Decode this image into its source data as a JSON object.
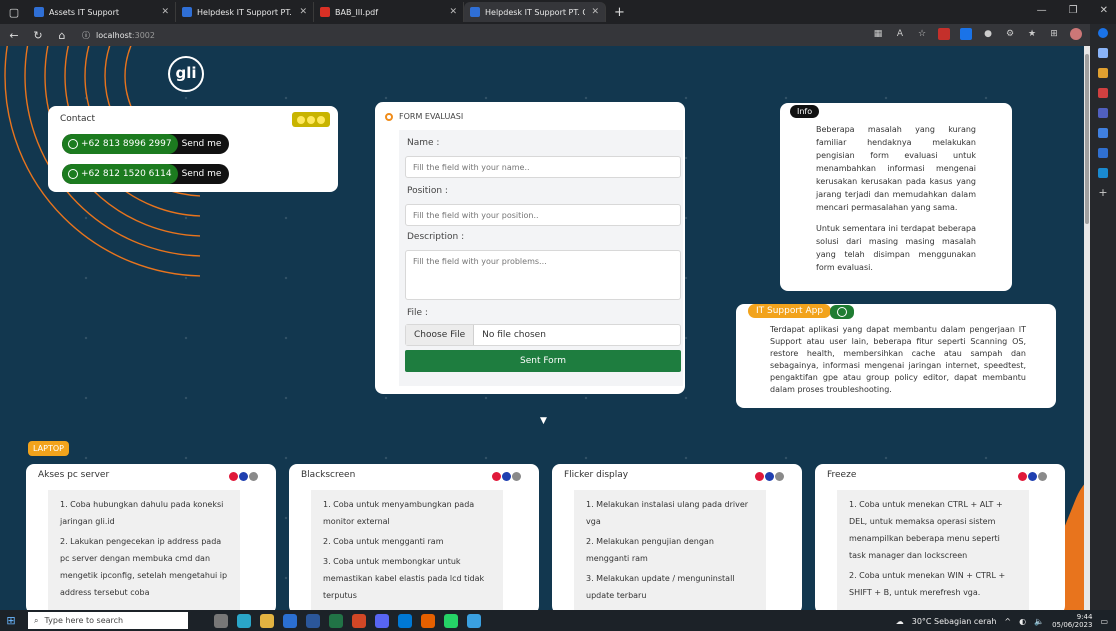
{
  "browser": {
    "tabs": [
      {
        "title": "Assets IT Support",
        "icon_color": "#2f6fd6",
        "active": false
      },
      {
        "title": "Helpdesk IT Support PT. GLI",
        "icon_color": "#2f6fd6",
        "active": false
      },
      {
        "title": "BAB_III.pdf",
        "icon_color": "#d93025",
        "active": false
      },
      {
        "title": "Helpdesk IT Support PT. GLI",
        "icon_color": "#2f6fd6",
        "active": true
      }
    ],
    "new_tab": "+",
    "url_host": "localhost",
    "url_port": ":3002"
  },
  "logo": "gli",
  "contact": {
    "title": "Contact",
    "items": [
      {
        "number": "+62 813 8996 2997",
        "action": "Send me"
      },
      {
        "number": "+62 812 1520 6114",
        "action": "Send me"
      }
    ]
  },
  "form": {
    "title": "FORM EVALUASI",
    "name_label": "Name :",
    "name_placeholder": "Fill the field with your name..",
    "position_label": "Position :",
    "position_placeholder": "Fill the field with your position..",
    "description_label": "Description :",
    "description_placeholder": "Fill the field with your problems...",
    "file_label": "File :",
    "choose_file": "Choose File",
    "no_file": "No file chosen",
    "submit": "Sent Form"
  },
  "info": {
    "badge": "Info",
    "paragraphs": [
      "Beberapa masalah yang kurang familiar hendaknya melakukan pengisian form evaluasi untuk menambahkan informasi mengenai kerusakan kerusakan pada kasus yang jarang terjadi dan memudahkan dalam mencari permasalahan yang sama.",
      "Untuk sementara ini terdapat beberapa solusi dari masing masing masalah yang telah disimpan menggunakan form evaluasi."
    ]
  },
  "itapp": {
    "badge": "IT Support App",
    "text": "Terdapat aplikasi yang dapat membantu dalam pengerjaan IT Support atau user lain, beberapa fitur seperti Scanning OS, restore health, membersihkan cache atau sampah dan sebagainya, informasi mengenai jaringan internet, speedtest, pengaktifan gpe atau group policy editor, dapat membantu dalam proses troubleshooting."
  },
  "section_label": "LAPTOP",
  "problems": [
    {
      "title": "Akses pc server",
      "steps": [
        "1. Coba hubungkan dahulu pada koneksi jaringan gli.id",
        "2. Lakukan pengecekan ip address pada pc server dengan membuka cmd dan mengetik ipconfig, setelah mengetahui ip address tersebut coba"
      ]
    },
    {
      "title": "Blackscreen",
      "steps": [
        "1. Coba untuk menyambungkan pada monitor external",
        "2. Coba untuk mengganti ram",
        "3. Coba untuk membongkar untuk memastikan kabel elastis pada lcd tidak terputus"
      ]
    },
    {
      "title": "Flicker display",
      "steps": [
        "1. Melakukan instalasi ulang pada driver vga",
        "2. Melakukan pengujian dengan mengganti ram",
        "3. Melakukan update / menguninstall update terbaru"
      ]
    },
    {
      "title": "Freeze",
      "steps": [
        "1. Coba untuk menekan CTRL + ALT + DEL, untuk memaksa operasi sistem menampilkan beberapa menu seperti task manager dan lockscreen",
        "2. Coba untuk menekan WIN + CTRL + SHIFT + B, untuk merefresh vga."
      ]
    }
  ],
  "colors": {
    "accent_orange": "#f2a31c",
    "green": "#1e7d3f",
    "page_bg": "#12374f"
  },
  "taskbar": {
    "search_placeholder": "Type here to search",
    "weather": "30°C  Sebagian cerah",
    "time": "9:44",
    "date": "05/06/2023"
  }
}
